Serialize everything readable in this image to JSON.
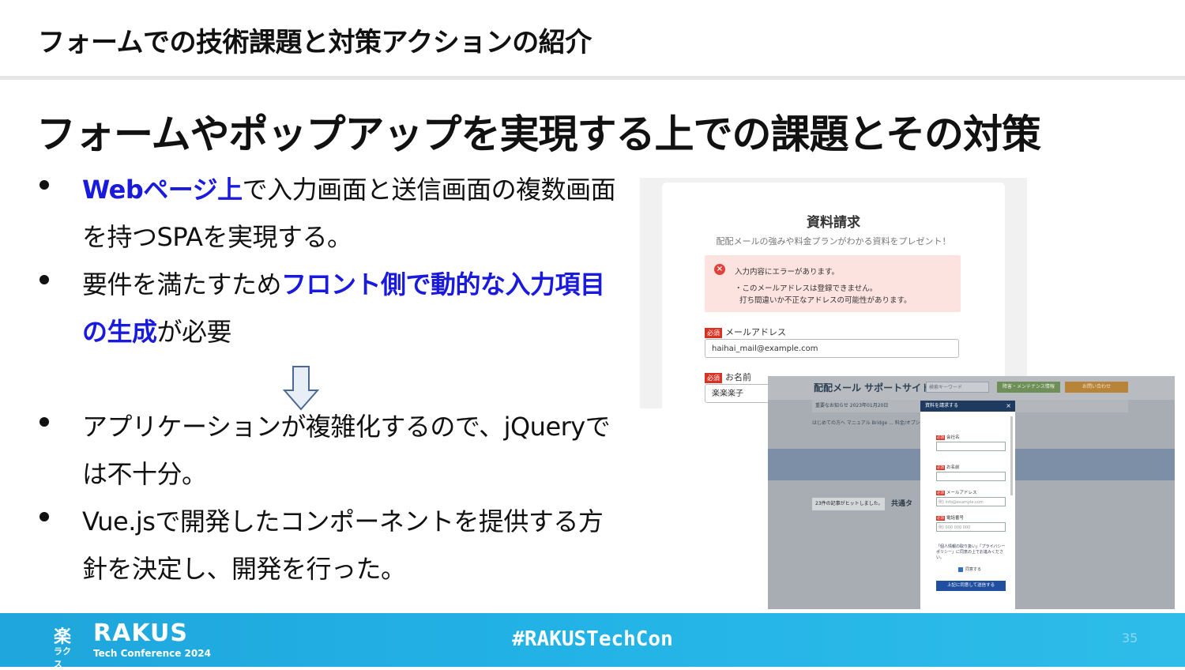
{
  "header": {
    "title": "フォームでの技術課題と対策アクションの紹介"
  },
  "slide": {
    "title": "フォームやポップアップを実現する上での課題とその対策",
    "bullets": [
      {
        "parts": [
          {
            "text": "Webページ上",
            "hl": true
          },
          {
            "text": "で入力画面と送信画面の複数画面を持つSPAを実現する。",
            "hl": false
          }
        ]
      },
      {
        "parts": [
          {
            "text": "要件を満たすため",
            "hl": false
          },
          {
            "text": "フロント側で動的な入力項目の生成",
            "hl": true
          },
          {
            "text": "が必要",
            "hl": false
          }
        ]
      },
      {
        "parts": [
          {
            "text": "アプリケーションが複雑化するので、jQueryでは不十分。",
            "hl": false
          }
        ]
      },
      {
        "parts": [
          {
            "text": "Vue.jsで開発したコンポーネントを提供する方針を決定し、開発を行った。",
            "hl": false
          }
        ]
      }
    ]
  },
  "screenshot1": {
    "title": "資料請求",
    "subtitle": "配配メールの強みや料金プランがわかる資料をプレゼント！",
    "error_icon": "close-circle-icon",
    "error_head": "入力内容にエラーがあります。",
    "error_line1": "・このメールアドレスは登録できません。",
    "error_line2": "打ち間違いか不正なアドレスの可能性があります。",
    "required_badge": "必須",
    "email_label": "メールアドレス",
    "email_value": "haihai_mail@example.com",
    "name_label": "お名前",
    "name_value": "楽楽楽子"
  },
  "screenshot2": {
    "logo": "配配メール サポートサイト",
    "search_placeholder": "検索キーワード",
    "maintenance_button": "障害・メンテナンス情報",
    "contact_button": "お問い合わせ",
    "news": "重要なお知らせ  2023年01月20日",
    "nav": "はじめての方へ   マニュアル   Bridge   ...   料金/オプション   セミナー",
    "result_count": "23件の記事がヒットしました。",
    "article_title": "共通タ",
    "modal_title": "資料を請求する",
    "modal_close": "×",
    "fields": [
      {
        "label": "会社名",
        "placeholder": ""
      },
      {
        "label": "お名前",
        "placeholder": ""
      },
      {
        "label": "メールアドレス",
        "placeholder": "例) info@example.com"
      },
      {
        "label": "電話番号",
        "placeholder": "例) 000 000 000"
      }
    ],
    "policy_text": "「個人情報の取り扱い」「プライバシーポリシー」に同意の上でお進みください。",
    "agree_label": "同意する",
    "submit_label": "上記に同意して送信する"
  },
  "footer": {
    "mark_top": "楽",
    "mark_bottom": "ラクス",
    "logo": "RAKUS",
    "logo_sub": "Tech Conference 2024",
    "hashtag": "#RAKUSTechCon",
    "page_number": "35"
  }
}
